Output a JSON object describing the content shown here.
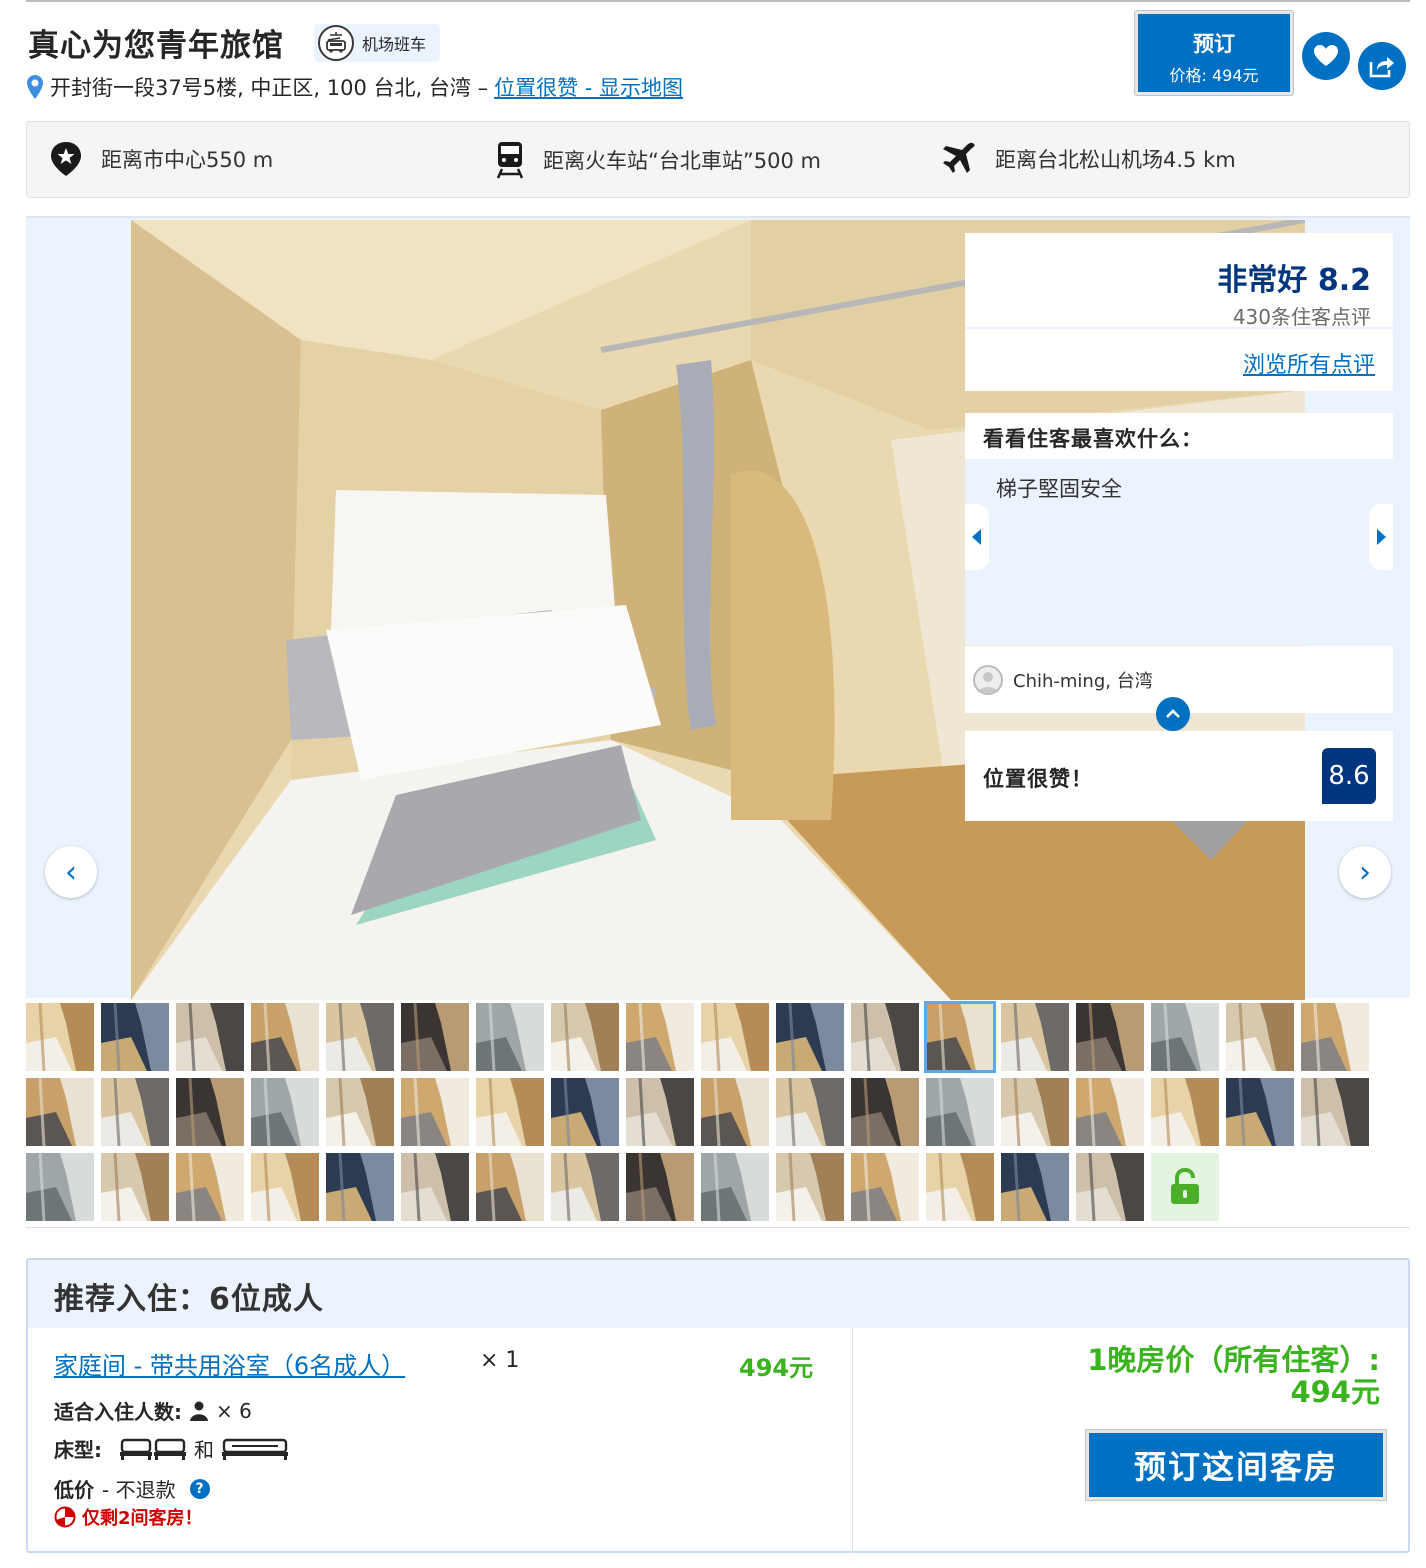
{
  "header": {
    "title": "真心为您青年旅馆",
    "shuttle_badge": "机场班车",
    "address": "开封街一段37号5楼, 中正区, 100 台北, 台湾 –",
    "map_link": "位置很赞 - 显示地图",
    "reserve_label": "预订",
    "reserve_price": "价格:  494元"
  },
  "distances": [
    {
      "icon": "city-center-icon",
      "text": "距离市中心550 m"
    },
    {
      "icon": "train-icon",
      "text": "距离火车站“台北車站”500 m"
    },
    {
      "icon": "airplane-icon",
      "text": "距离台北松山机场4.5 km"
    }
  ],
  "reviews": {
    "rating_text": "非常好 8.2",
    "count_text": "430条住客点评",
    "all_reviews_link": "浏览所有点评",
    "likes_heading": "看看住客最喜欢什么：",
    "likes_quote": "梯子堅固安全",
    "reviewer": "Chih-ming, 台湾",
    "location_label": "位置很赞！",
    "location_score": "8.6"
  },
  "gallery": {
    "prev_arrow": "‹",
    "next_arrow": "›",
    "thumbnail_count": 52,
    "selected_thumbnail": 12
  },
  "recommendation": {
    "heading": "推荐入住：6位成人",
    "room_link": "家庭间 - 带共用浴室（6名成人）",
    "room_qty": "× 1",
    "room_price": "494元",
    "occupancy_label": "适合入住人数:",
    "occupancy_value": "× 6",
    "bed_label": "床型:",
    "bed_and": "和",
    "price_label": "低价",
    "price_policy": "- 不退款",
    "help": "?",
    "warning": "仅剩2间客房！",
    "total_label": "1晚房价（所有住客）:",
    "total_price": "494元",
    "book_button": "预订这间客房"
  },
  "colors": {
    "brand_blue": "#0071c2",
    "dark_blue": "#003580",
    "price_green": "#3ab31f",
    "panel_bg": "#ebf3ff",
    "warning_red": "#cc0000"
  }
}
